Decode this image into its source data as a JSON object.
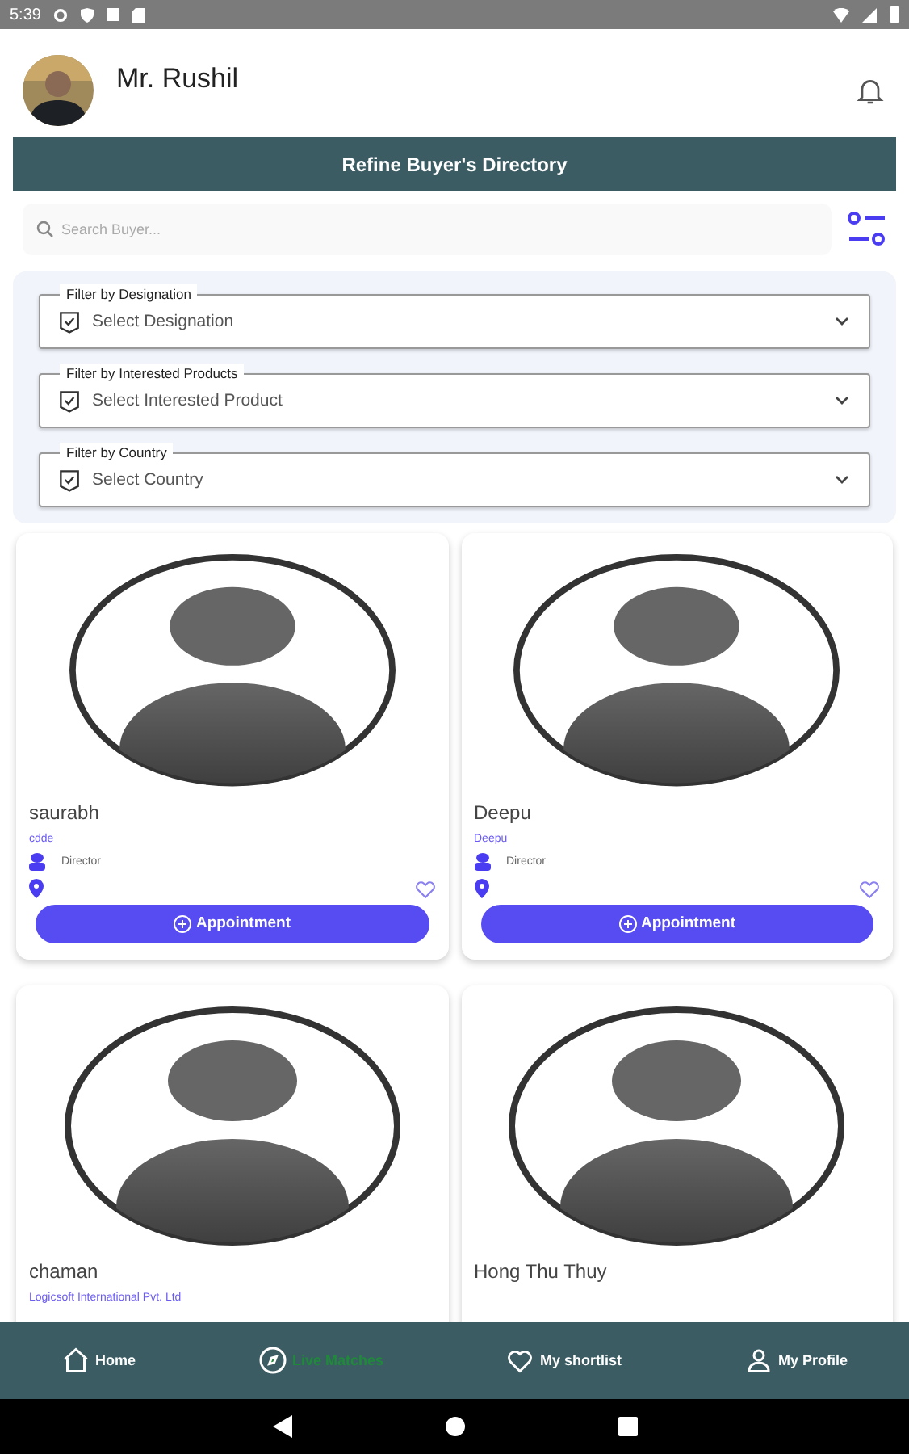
{
  "status_bar": {
    "time": "5:39"
  },
  "header": {
    "user_name": "Mr. Rushil"
  },
  "banner": {
    "title": "Refine Buyer's Directory"
  },
  "search": {
    "placeholder": "Search Buyer..."
  },
  "filters": [
    {
      "label": "Filter by Designation",
      "placeholder": "Select Designation"
    },
    {
      "label": "Filter by Interested Products",
      "placeholder": "Select Interested Product"
    },
    {
      "label": "Filter by Country",
      "placeholder": "Select Country"
    }
  ],
  "buyers": [
    {
      "name": "saurabh",
      "company": "cdde",
      "designation": "Director",
      "favorite": false,
      "button": "Appointment"
    },
    {
      "name": "Deepu",
      "company": "Deepu",
      "designation": "Director",
      "favorite": false,
      "button": "Appointment"
    },
    {
      "name": "chaman",
      "company": "Logicsoft International Pvt. Ltd"
    },
    {
      "name": "Hong Thu Thuy"
    }
  ],
  "bottom_nav": [
    {
      "label": "Home",
      "selected": false
    },
    {
      "label": "Live Matches",
      "selected": true
    },
    {
      "label": "My shortlist",
      "selected": false
    },
    {
      "label": "My Profile",
      "selected": false
    }
  ]
}
